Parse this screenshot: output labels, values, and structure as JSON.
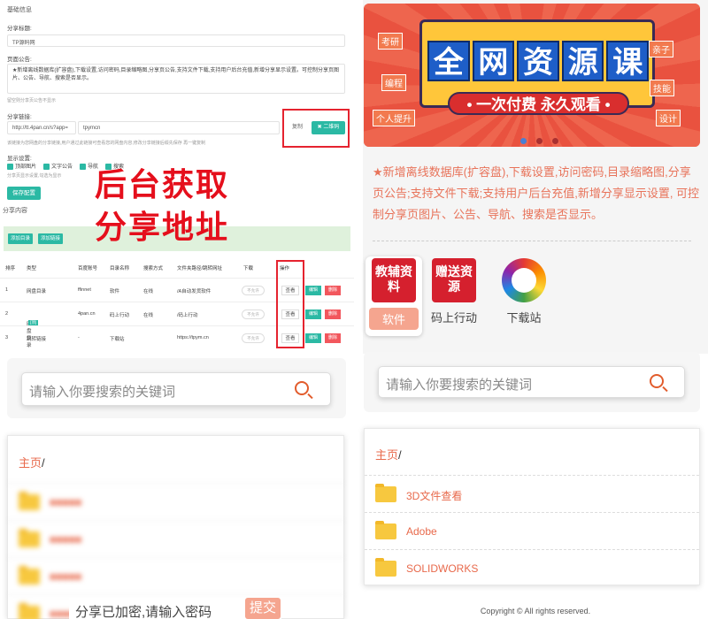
{
  "admin": {
    "section_basic": "基础信息",
    "share_title_label": "分享标题:",
    "share_title_value": "TP源码网",
    "notice_label": "页面公告:",
    "notice_value": "★新增离线数据库(扩容盘),下载设置,访问密码,目录缩略图,分享页公告,支持文件下载,支持用户后台充值,新增分享显示设置。可控制分享页图片、公告、导航、搜索是否显示。",
    "notice_hint": "留空则分享页公告不显示",
    "link_label": "分享链接:",
    "link_value": "http://tt.4pan.cn/s?app=",
    "link_code": "tpymcn",
    "copy_label": "复制",
    "qr_label": "二维码",
    "link_hint": "该链接为您网盘的分享链接,用户通过此链接可查看您的网盘内容,修改分享链接后缀先保存 再一键复制",
    "display_label": "显示设置:",
    "checks": [
      "顶部图片",
      "文字公告",
      "导航",
      "搜索"
    ],
    "display_hint": "分享页显示设置,勾选为显示",
    "save_label": "保存配置",
    "share_content": "分享内容",
    "add_dir": "添加目录",
    "add_link": "添加链接",
    "columns": [
      "排序",
      "类型",
      "百度账号",
      "目录名称",
      "搜索方式",
      "文件夹路径/跳转网址",
      "下载",
      "操作"
    ],
    "rows": [
      {
        "sort": "1",
        "type": "网盘目录",
        "account": "ffinnet",
        "name": "软件",
        "mode": "在线",
        "path": "/A自动发货软件",
        "download": "不允许",
        "top": ""
      },
      {
        "sort": "2",
        "type": "网盘目录",
        "account": "4pan.cn",
        "name": "码上行动",
        "mode": "在线",
        "path": "/码上行动",
        "download": "不允许",
        "top": "[顶]"
      },
      {
        "sort": "3",
        "type": "跳转链接",
        "account": "-",
        "name": "下载站",
        "mode": "",
        "path": "https://tpym.cn",
        "download": "不允许",
        "top": ""
      }
    ],
    "view_label": "查看",
    "edit_label": "编辑",
    "del_label": "删除",
    "overlay_line1": "后台获取",
    "overlay_line2": "分享地址"
  },
  "banner": {
    "title_chars": [
      "全",
      "网",
      "资",
      "源",
      "课"
    ],
    "subtitle": "• 一次付费  永久观看 •",
    "tags": [
      "考研",
      "编程",
      "个人提升",
      "亲子",
      "技能",
      "设计"
    ]
  },
  "desc": "★新增离线数据库(扩容盘),下载设置,访问密码,目录缩略图,分享页公告;支持文件下载;支持用户后台充值,新增分享显示设置, 可控制分享页图片、公告、导航、搜索是否显示。",
  "categories": [
    {
      "label": "软件",
      "icon_text": "教辅资料"
    },
    {
      "label": "码上行动",
      "icon_text": "赠送资源"
    },
    {
      "label": "下载站",
      "icon_text": ""
    }
  ],
  "search": {
    "placeholder": "请输入你要搜索的关键词"
  },
  "breadcrumb": {
    "home": "主页",
    "sep": "/"
  },
  "files": [
    "3D文件查看",
    "Adobe",
    "SOLIDWORKS"
  ],
  "blurred_files": [
    "■■■■■",
    "■■■■■",
    "■■■■■",
    "■■■■■",
    "■■■■■"
  ],
  "password": {
    "prompt": "分享已加密,请输入密码",
    "submit": "提交"
  },
  "footer": {
    "copyright": "Copyright © All rights reserved."
  },
  "colors": {
    "accent": "#2bb9a4",
    "danger": "#f2575d",
    "highlight": "#e50f1c",
    "link": "#e8694b"
  }
}
